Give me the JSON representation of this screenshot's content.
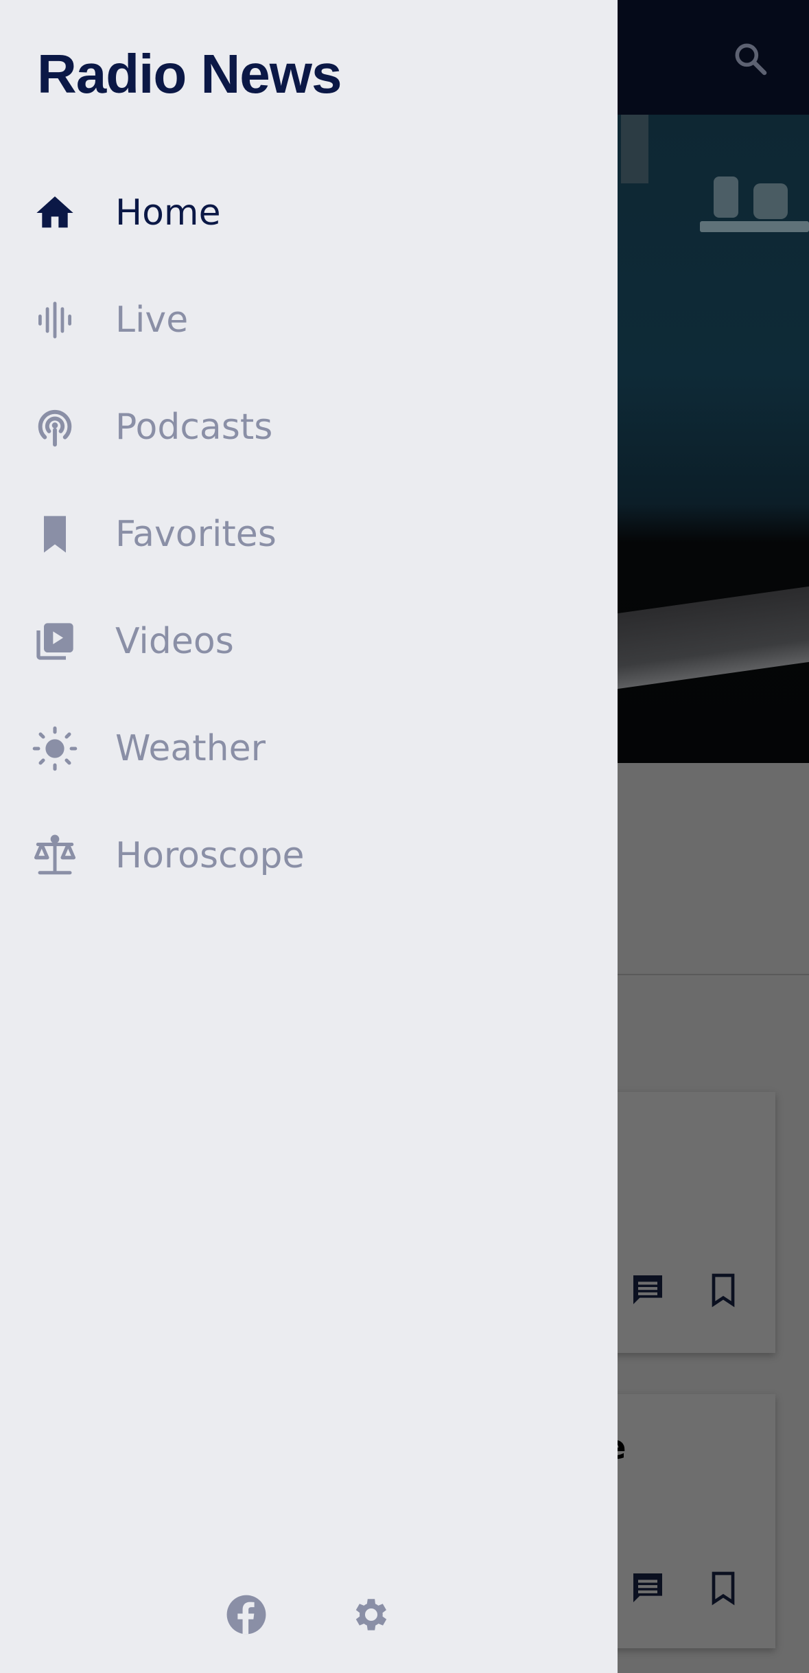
{
  "app": {
    "title": "Radio News",
    "background_title_fragment": "e"
  },
  "colors": {
    "drawer_bg": "#ebecf0",
    "primary": "#0b1846",
    "inactive": "#8a8fa6"
  },
  "topbar": {
    "search_icon": "search-icon"
  },
  "drawer": {
    "items": [
      {
        "label": "Home",
        "icon": "home-icon",
        "active": true
      },
      {
        "label": "Live",
        "icon": "audio-wave-icon",
        "active": false
      },
      {
        "label": "Podcasts",
        "icon": "podcast-icon",
        "active": false
      },
      {
        "label": "Favorites",
        "icon": "bookmark-icon",
        "active": false
      },
      {
        "label": "Videos",
        "icon": "video-library-icon",
        "active": false
      },
      {
        "label": "Weather",
        "icon": "sun-icon",
        "active": false
      },
      {
        "label": "Horoscope",
        "icon": "scales-icon",
        "active": false
      }
    ],
    "footer": {
      "facebook_icon": "facebook-icon",
      "settings_icon": "gear-icon"
    }
  }
}
